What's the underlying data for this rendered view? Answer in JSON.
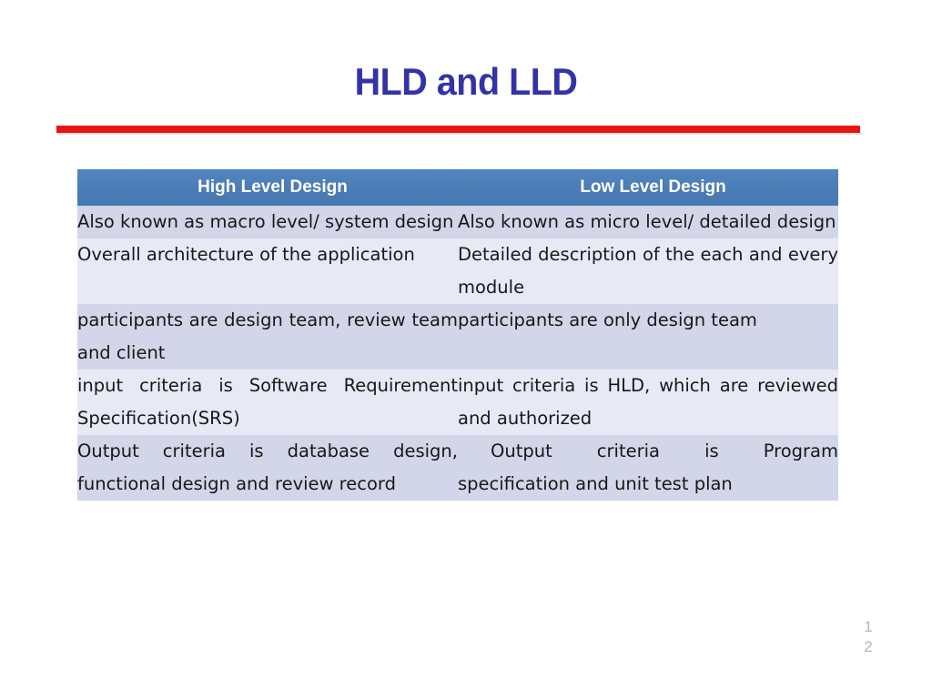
{
  "slide": {
    "title": "HLD and LLD",
    "page_number": "12",
    "accent_rule_color": "#e81414",
    "title_color": "#3333a8",
    "header_fill_color": "#4a7cb5",
    "row_dark_color": "#d2d6e8",
    "row_light_color": "#e7eaf5"
  },
  "table": {
    "headers": [
      "High Level Design",
      "Low Level Design"
    ],
    "rows": [
      {
        "left": "Also known as macro level/ system design",
        "right": "Also known as micro level/ detailed design"
      },
      {
        "left": "Overall architecture of the application",
        "right": "Detailed description of the each and every module"
      },
      {
        "left": "participants are design team, review team and client",
        "right": "participants are only design team"
      },
      {
        "left": "input criteria is Software Requirement Specification(SRS)",
        "right": "input criteria is HLD, which are reviewed and authorized"
      },
      {
        "left": "Output criteria is database design, functional design and review record",
        "right": "Output criteria is Program specification and unit test plan"
      }
    ]
  }
}
